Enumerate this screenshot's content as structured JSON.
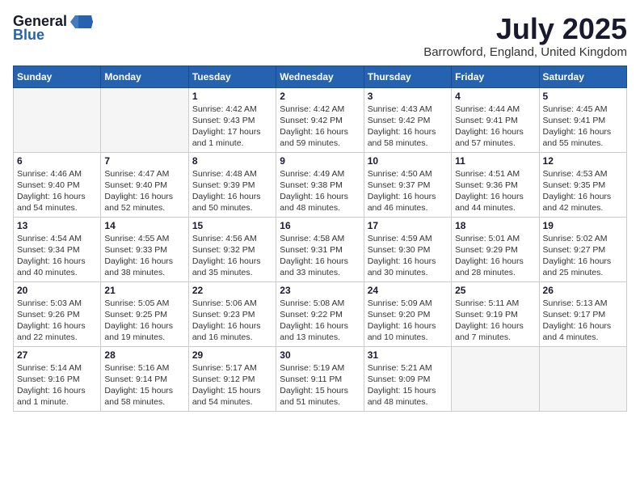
{
  "logo": {
    "general": "General",
    "blue": "Blue"
  },
  "title": "July 2025",
  "location": "Barrowford, England, United Kingdom",
  "weekdays": [
    "Sunday",
    "Monday",
    "Tuesday",
    "Wednesday",
    "Thursday",
    "Friday",
    "Saturday"
  ],
  "weeks": [
    [
      {
        "day": "",
        "detail": ""
      },
      {
        "day": "",
        "detail": ""
      },
      {
        "day": "1",
        "detail": "Sunrise: 4:42 AM\nSunset: 9:43 PM\nDaylight: 17 hours\nand 1 minute."
      },
      {
        "day": "2",
        "detail": "Sunrise: 4:42 AM\nSunset: 9:42 PM\nDaylight: 16 hours\nand 59 minutes."
      },
      {
        "day": "3",
        "detail": "Sunrise: 4:43 AM\nSunset: 9:42 PM\nDaylight: 16 hours\nand 58 minutes."
      },
      {
        "day": "4",
        "detail": "Sunrise: 4:44 AM\nSunset: 9:41 PM\nDaylight: 16 hours\nand 57 minutes."
      },
      {
        "day": "5",
        "detail": "Sunrise: 4:45 AM\nSunset: 9:41 PM\nDaylight: 16 hours\nand 55 minutes."
      }
    ],
    [
      {
        "day": "6",
        "detail": "Sunrise: 4:46 AM\nSunset: 9:40 PM\nDaylight: 16 hours\nand 54 minutes."
      },
      {
        "day": "7",
        "detail": "Sunrise: 4:47 AM\nSunset: 9:40 PM\nDaylight: 16 hours\nand 52 minutes."
      },
      {
        "day": "8",
        "detail": "Sunrise: 4:48 AM\nSunset: 9:39 PM\nDaylight: 16 hours\nand 50 minutes."
      },
      {
        "day": "9",
        "detail": "Sunrise: 4:49 AM\nSunset: 9:38 PM\nDaylight: 16 hours\nand 48 minutes."
      },
      {
        "day": "10",
        "detail": "Sunrise: 4:50 AM\nSunset: 9:37 PM\nDaylight: 16 hours\nand 46 minutes."
      },
      {
        "day": "11",
        "detail": "Sunrise: 4:51 AM\nSunset: 9:36 PM\nDaylight: 16 hours\nand 44 minutes."
      },
      {
        "day": "12",
        "detail": "Sunrise: 4:53 AM\nSunset: 9:35 PM\nDaylight: 16 hours\nand 42 minutes."
      }
    ],
    [
      {
        "day": "13",
        "detail": "Sunrise: 4:54 AM\nSunset: 9:34 PM\nDaylight: 16 hours\nand 40 minutes."
      },
      {
        "day": "14",
        "detail": "Sunrise: 4:55 AM\nSunset: 9:33 PM\nDaylight: 16 hours\nand 38 minutes."
      },
      {
        "day": "15",
        "detail": "Sunrise: 4:56 AM\nSunset: 9:32 PM\nDaylight: 16 hours\nand 35 minutes."
      },
      {
        "day": "16",
        "detail": "Sunrise: 4:58 AM\nSunset: 9:31 PM\nDaylight: 16 hours\nand 33 minutes."
      },
      {
        "day": "17",
        "detail": "Sunrise: 4:59 AM\nSunset: 9:30 PM\nDaylight: 16 hours\nand 30 minutes."
      },
      {
        "day": "18",
        "detail": "Sunrise: 5:01 AM\nSunset: 9:29 PM\nDaylight: 16 hours\nand 28 minutes."
      },
      {
        "day": "19",
        "detail": "Sunrise: 5:02 AM\nSunset: 9:27 PM\nDaylight: 16 hours\nand 25 minutes."
      }
    ],
    [
      {
        "day": "20",
        "detail": "Sunrise: 5:03 AM\nSunset: 9:26 PM\nDaylight: 16 hours\nand 22 minutes."
      },
      {
        "day": "21",
        "detail": "Sunrise: 5:05 AM\nSunset: 9:25 PM\nDaylight: 16 hours\nand 19 minutes."
      },
      {
        "day": "22",
        "detail": "Sunrise: 5:06 AM\nSunset: 9:23 PM\nDaylight: 16 hours\nand 16 minutes."
      },
      {
        "day": "23",
        "detail": "Sunrise: 5:08 AM\nSunset: 9:22 PM\nDaylight: 16 hours\nand 13 minutes."
      },
      {
        "day": "24",
        "detail": "Sunrise: 5:09 AM\nSunset: 9:20 PM\nDaylight: 16 hours\nand 10 minutes."
      },
      {
        "day": "25",
        "detail": "Sunrise: 5:11 AM\nSunset: 9:19 PM\nDaylight: 16 hours\nand 7 minutes."
      },
      {
        "day": "26",
        "detail": "Sunrise: 5:13 AM\nSunset: 9:17 PM\nDaylight: 16 hours\nand 4 minutes."
      }
    ],
    [
      {
        "day": "27",
        "detail": "Sunrise: 5:14 AM\nSunset: 9:16 PM\nDaylight: 16 hours\nand 1 minute."
      },
      {
        "day": "28",
        "detail": "Sunrise: 5:16 AM\nSunset: 9:14 PM\nDaylight: 15 hours\nand 58 minutes."
      },
      {
        "day": "29",
        "detail": "Sunrise: 5:17 AM\nSunset: 9:12 PM\nDaylight: 15 hours\nand 54 minutes."
      },
      {
        "day": "30",
        "detail": "Sunrise: 5:19 AM\nSunset: 9:11 PM\nDaylight: 15 hours\nand 51 minutes."
      },
      {
        "day": "31",
        "detail": "Sunrise: 5:21 AM\nSunset: 9:09 PM\nDaylight: 15 hours\nand 48 minutes."
      },
      {
        "day": "",
        "detail": ""
      },
      {
        "day": "",
        "detail": ""
      }
    ]
  ]
}
